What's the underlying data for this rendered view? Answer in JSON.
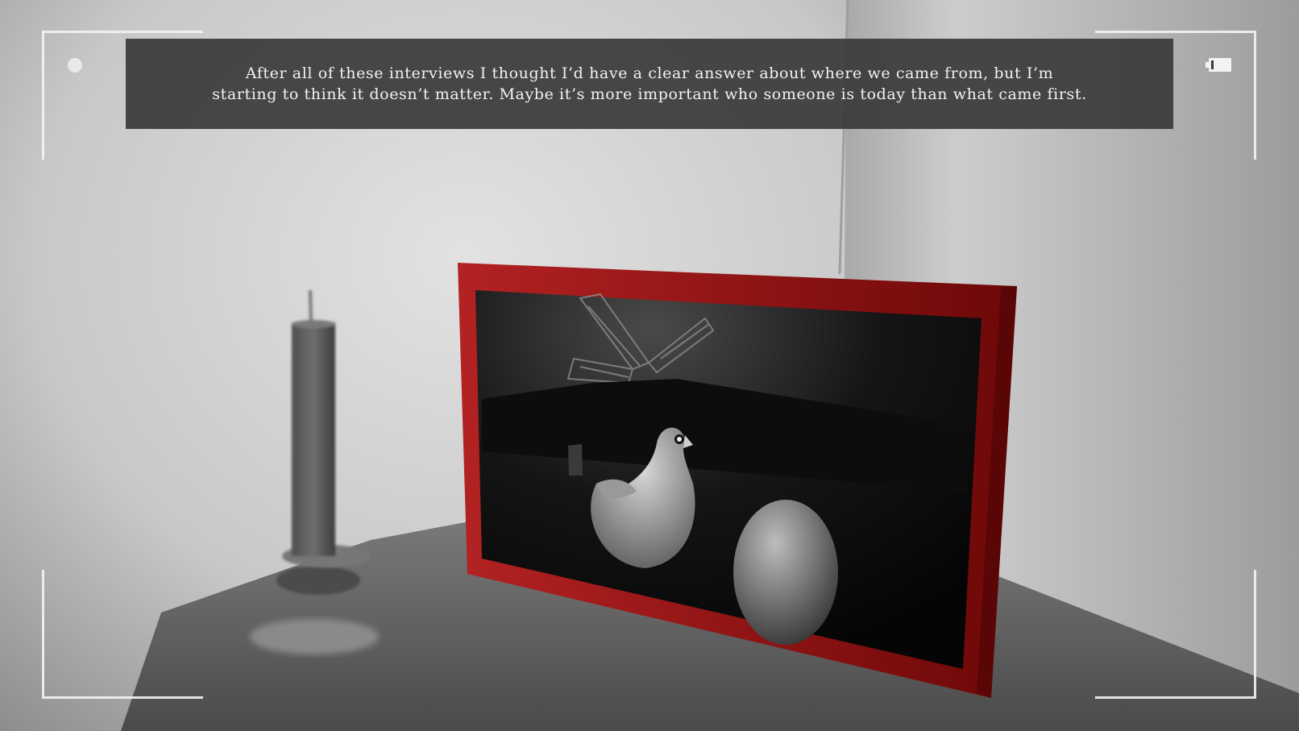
{
  "subtitle": {
    "line1": "After all of these interviews I thought I’d have a clear answer about where we came from, but I’m",
    "line2": "starting to think it doesn’t matter. Maybe it’s more important who someone is today than what came first."
  },
  "hud": {
    "recording_indicator": "rec-dot-icon",
    "battery_icon": "battery-icon",
    "battery_level": 0.12
  },
  "scene": {
    "frame_color": "#b01818",
    "objects": [
      "candle",
      "candle-holder",
      "picture-frame",
      "painting-windmill",
      "painting-rooster",
      "painting-egg",
      "table",
      "room-walls"
    ]
  }
}
